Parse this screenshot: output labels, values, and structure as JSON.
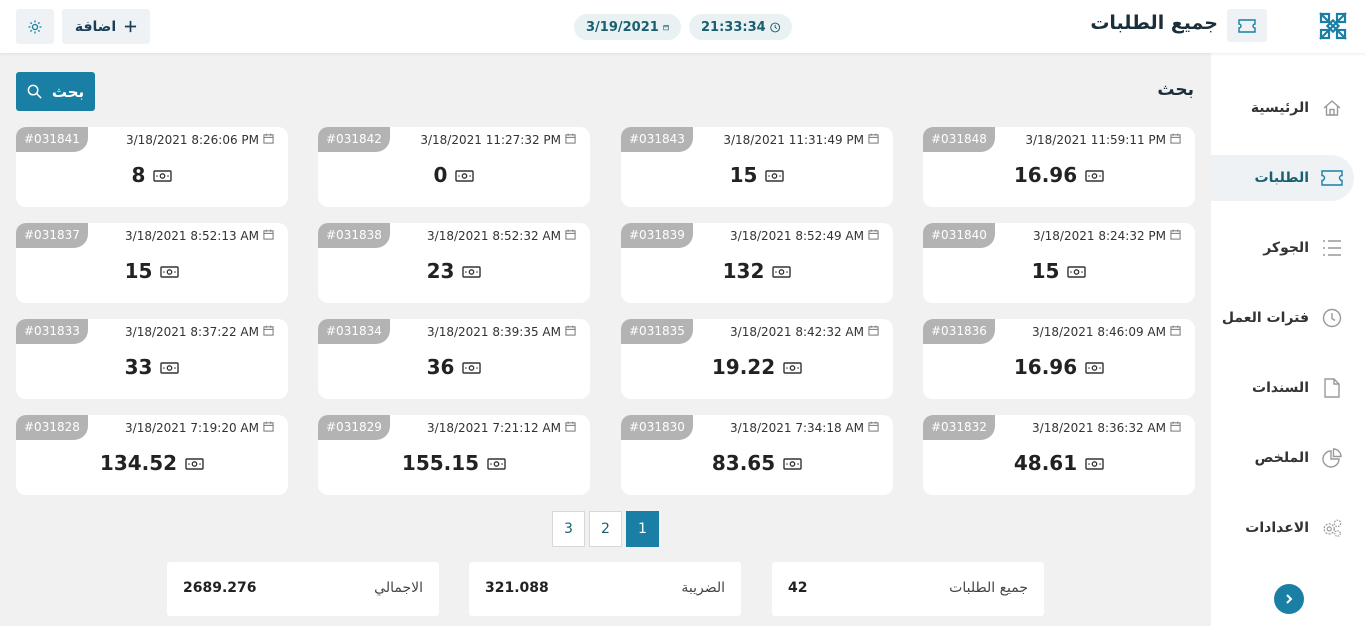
{
  "header": {
    "title": "جميع الطلبات",
    "time": "21:33:34",
    "date": "3/19/2021",
    "add_label": "اضافة"
  },
  "sidebar": {
    "items": [
      {
        "label": "الرئيسية",
        "icon": "home-icon"
      },
      {
        "label": "الطلبات",
        "icon": "ticket-icon",
        "active": true
      },
      {
        "label": "الجوكر",
        "icon": "list-icon"
      },
      {
        "label": "فترات العمل",
        "icon": "clock-icon"
      },
      {
        "label": "السندات",
        "icon": "document-icon"
      },
      {
        "label": "الملخص",
        "icon": "chart-icon"
      },
      {
        "label": "الاعدادات",
        "icon": "gears-icon"
      }
    ]
  },
  "search": {
    "label": "بحث",
    "button_label": "بحث"
  },
  "orders": [
    {
      "id": "#031848",
      "datetime": "3/18/2021 11:59:11 PM",
      "amount": "16.96"
    },
    {
      "id": "#031843",
      "datetime": "3/18/2021 11:31:49 PM",
      "amount": "15"
    },
    {
      "id": "#031842",
      "datetime": "3/18/2021 11:27:32 PM",
      "amount": "0"
    },
    {
      "id": "#031841",
      "datetime": "3/18/2021 8:26:06 PM",
      "amount": "8"
    },
    {
      "id": "#031840",
      "datetime": "3/18/2021 8:24:32 PM",
      "amount": "15"
    },
    {
      "id": "#031839",
      "datetime": "3/18/2021 8:52:49 AM",
      "amount": "132"
    },
    {
      "id": "#031838",
      "datetime": "3/18/2021 8:52:32 AM",
      "amount": "23"
    },
    {
      "id": "#031837",
      "datetime": "3/18/2021 8:52:13 AM",
      "amount": "15"
    },
    {
      "id": "#031836",
      "datetime": "3/18/2021 8:46:09 AM",
      "amount": "16.96"
    },
    {
      "id": "#031835",
      "datetime": "3/18/2021 8:42:32 AM",
      "amount": "19.22"
    },
    {
      "id": "#031834",
      "datetime": "3/18/2021 8:39:35 AM",
      "amount": "36"
    },
    {
      "id": "#031833",
      "datetime": "3/18/2021 8:37:22 AM",
      "amount": "33"
    },
    {
      "id": "#031832",
      "datetime": "3/18/2021 8:36:32 AM",
      "amount": "48.61"
    },
    {
      "id": "#031830",
      "datetime": "3/18/2021 7:34:18 AM",
      "amount": "83.65"
    },
    {
      "id": "#031829",
      "datetime": "3/18/2021 7:21:12 AM",
      "amount": "155.15"
    },
    {
      "id": "#031828",
      "datetime": "3/18/2021 7:19:20 AM",
      "amount": "134.52"
    }
  ],
  "pagination": {
    "pages": [
      "1",
      "2",
      "3"
    ],
    "current": "1"
  },
  "summary": [
    {
      "label": "جميع الطلبات",
      "value": "42"
    },
    {
      "label": "الضريبة",
      "value": "321.088"
    },
    {
      "label": "الاجمالي",
      "value": "2689.276"
    }
  ],
  "colors": {
    "accent": "#1a7fa4",
    "badge": "#b3b3b3",
    "background": "#f1f1f1"
  }
}
